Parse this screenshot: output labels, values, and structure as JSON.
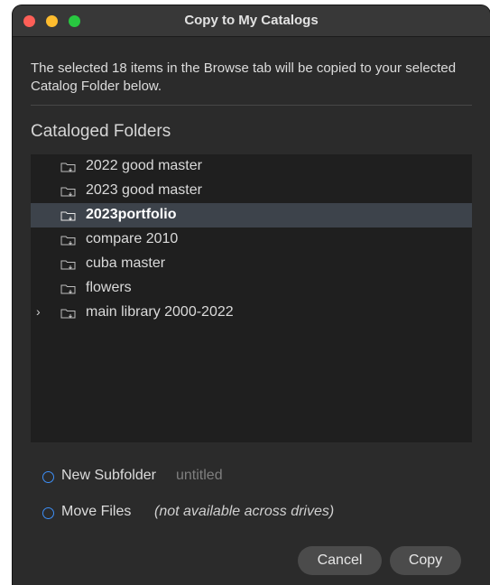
{
  "window": {
    "title": "Copy to My Catalogs"
  },
  "message": "The selected 18 items in the Browse tab will be copied to your selected Catalog Folder below.",
  "section_title": "Cataloged Folders",
  "folders": [
    {
      "label": "2022 good master",
      "selected": false,
      "expandable": false
    },
    {
      "label": "2023 good master",
      "selected": false,
      "expandable": false
    },
    {
      "label": "2023portfolio",
      "selected": true,
      "expandable": false
    },
    {
      "label": "compare 2010",
      "selected": false,
      "expandable": false
    },
    {
      "label": "cuba master",
      "selected": false,
      "expandable": false
    },
    {
      "label": "flowers",
      "selected": false,
      "expandable": false
    },
    {
      "label": "main library 2000-2022",
      "selected": false,
      "expandable": true
    }
  ],
  "options": {
    "new_subfolder_label": "New Subfolder",
    "new_subfolder_value": "untitled",
    "move_files_label": "Move Files",
    "move_files_note": "(not available across drives)"
  },
  "buttons": {
    "cancel": "Cancel",
    "copy": "Copy"
  },
  "colors": {
    "accent": "#3d8ff7",
    "window_bg": "#2b2b2b",
    "list_bg": "#1f1f1f",
    "selected_row": "#3d434b"
  }
}
